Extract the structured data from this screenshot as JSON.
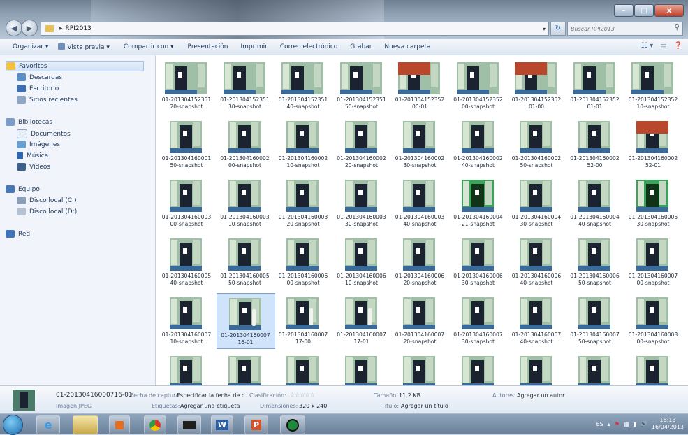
{
  "window": {
    "path": [
      "RPI2013"
    ],
    "search_placeholder": "Buscar RPI2013"
  },
  "toolbar": {
    "organize": "Organizar ▾",
    "preview": "Vista previa ▾",
    "share": "Compartir con ▾",
    "slideshow": "Presentación",
    "print": "Imprimir",
    "email": "Correo electrónico",
    "burn": "Grabar",
    "new_folder": "Nueva carpeta"
  },
  "sidebar": {
    "favorites": "Favoritos",
    "downloads": "Descargas",
    "desktop": "Escritorio",
    "recent": "Sitios recientes",
    "libraries": "Bibliotecas",
    "documents": "Documentos",
    "images": "Imágenes",
    "music": "Música",
    "videos": "Vídeos",
    "computer": "Equipo",
    "disk_c": "Disco local (C:)",
    "disk_d": "Disco local (D:)",
    "network": "Red"
  },
  "files": [
    {
      "l1": "01-201304152351",
      "l2": "20-snapshot",
      "k": "plain"
    },
    {
      "l1": "01-201304152351",
      "l2": "30-snapshot",
      "k": "plain"
    },
    {
      "l1": "01-201304152351",
      "l2": "40-snapshot",
      "k": "plain"
    },
    {
      "l1": "01-201304152351",
      "l2": "50-snapshot",
      "k": "plain"
    },
    {
      "l1": "01-201304152352",
      "l2": "00-01",
      "k": "red"
    },
    {
      "l1": "01-201304152352",
      "l2": "00-snapshot",
      "k": "plain"
    },
    {
      "l1": "01-201304152352",
      "l2": "01-00",
      "k": "red"
    },
    {
      "l1": "01-201304152352",
      "l2": "01-01",
      "k": "plain"
    },
    {
      "l1": "01-201304152352",
      "l2": "10-snapshot",
      "k": "plain"
    },
    {
      "l1": "01-201304160001",
      "l2": "50-snapshot",
      "k": "plain"
    },
    {
      "l1": "01-201304160002",
      "l2": "00-snapshot",
      "k": "plain"
    },
    {
      "l1": "01-201304160002",
      "l2": "10-snapshot",
      "k": "plain"
    },
    {
      "l1": "01-201304160002",
      "l2": "20-snapshot",
      "k": "plain"
    },
    {
      "l1": "01-201304160002",
      "l2": "30-snapshot",
      "k": "plain"
    },
    {
      "l1": "01-201304160002",
      "l2": "40-snapshot",
      "k": "plain"
    },
    {
      "l1": "01-201304160002",
      "l2": "50-snapshot",
      "k": "plain"
    },
    {
      "l1": "01-201304160002",
      "l2": "52-00",
      "k": "plain"
    },
    {
      "l1": "01-201304160002",
      "l2": "52-01",
      "k": "red"
    },
    {
      "l1": "01-201304160003",
      "l2": "00-snapshot",
      "k": "plain"
    },
    {
      "l1": "01-201304160003",
      "l2": "10-snapshot",
      "k": "plain"
    },
    {
      "l1": "01-201304160003",
      "l2": "20-snapshot",
      "k": "plain"
    },
    {
      "l1": "01-201304160003",
      "l2": "30-snapshot",
      "k": "plain"
    },
    {
      "l1": "01-201304160003",
      "l2": "40-snapshot",
      "k": "plain"
    },
    {
      "l1": "01-201304160004",
      "l2": "21-snapshot",
      "k": "green"
    },
    {
      "l1": "01-201304160004",
      "l2": "30-snapshot",
      "k": "plain"
    },
    {
      "l1": "01-201304160004",
      "l2": "40-snapshot",
      "k": "plain"
    },
    {
      "l1": "01-201304160005",
      "l2": "30-snapshot",
      "k": "green"
    },
    {
      "l1": "01-201304160005",
      "l2": "40-snapshot",
      "k": "plain"
    },
    {
      "l1": "01-201304160005",
      "l2": "50-snapshot",
      "k": "plain"
    },
    {
      "l1": "01-201304160006",
      "l2": "00-snapshot",
      "k": "plain"
    },
    {
      "l1": "01-201304160006",
      "l2": "10-snapshot",
      "k": "plain"
    },
    {
      "l1": "01-201304160006",
      "l2": "20-snapshot",
      "k": "plain"
    },
    {
      "l1": "01-201304160006",
      "l2": "30-snapshot",
      "k": "plain"
    },
    {
      "l1": "01-201304160006",
      "l2": "40-snapshot",
      "k": "plain"
    },
    {
      "l1": "01-201304160006",
      "l2": "50-snapshot",
      "k": "plain"
    },
    {
      "l1": "01-201304160007",
      "l2": "00-snapshot",
      "k": "plain"
    },
    {
      "l1": "01-201304160007",
      "l2": "10-snapshot",
      "k": "plain"
    },
    {
      "l1": "01-201304160007",
      "l2": "16-01",
      "k": "person",
      "selected": true
    },
    {
      "l1": "01-201304160007",
      "l2": "17-00",
      "k": "person"
    },
    {
      "l1": "01-201304160007",
      "l2": "17-01",
      "k": "person"
    },
    {
      "l1": "01-201304160007",
      "l2": "20-snapshot",
      "k": "plain"
    },
    {
      "l1": "01-201304160007",
      "l2": "30-snapshot",
      "k": "plain"
    },
    {
      "l1": "01-201304160007",
      "l2": "40-snapshot",
      "k": "plain"
    },
    {
      "l1": "01-201304160007",
      "l2": "50-snapshot",
      "k": "plain"
    },
    {
      "l1": "01-201304160008",
      "l2": "00-snapshot",
      "k": "plain"
    },
    {
      "l1": "",
      "l2": "",
      "k": "plain"
    },
    {
      "l1": "",
      "l2": "",
      "k": "plain"
    },
    {
      "l1": "",
      "l2": "",
      "k": "plain"
    },
    {
      "l1": "",
      "l2": "",
      "k": "plain"
    },
    {
      "l1": "",
      "l2": "",
      "k": "plain"
    },
    {
      "l1": "",
      "l2": "",
      "k": "plain"
    },
    {
      "l1": "",
      "l2": "",
      "k": "plain"
    },
    {
      "l1": "",
      "l2": "",
      "k": "plain"
    },
    {
      "l1": "",
      "l2": "",
      "k": "plain"
    }
  ],
  "details": {
    "filename": "01-20130416000716-01",
    "type": "Imagen JPEG",
    "date_label": "Fecha de captura:",
    "date_value": "Especificar la fecha de c...",
    "rating_label": "Clasificación:",
    "rating_value": "☆☆☆☆☆",
    "tags_label": "Etiquetas:",
    "tags_value": "Agregar una etiqueta",
    "dims_label": "Dimensiones:",
    "dims_value": "320 x 240",
    "size_label": "Tamaño:",
    "size_value": "11,2 KB",
    "title_label": "Título:",
    "title_value": "Agregar un título",
    "authors_label": "Autores:",
    "authors_value": "Agregar un autor"
  },
  "taskbar": {
    "lang": "ES",
    "time": "18:13",
    "date": "16/04/2013",
    "word": "W",
    "ppt": "P"
  }
}
